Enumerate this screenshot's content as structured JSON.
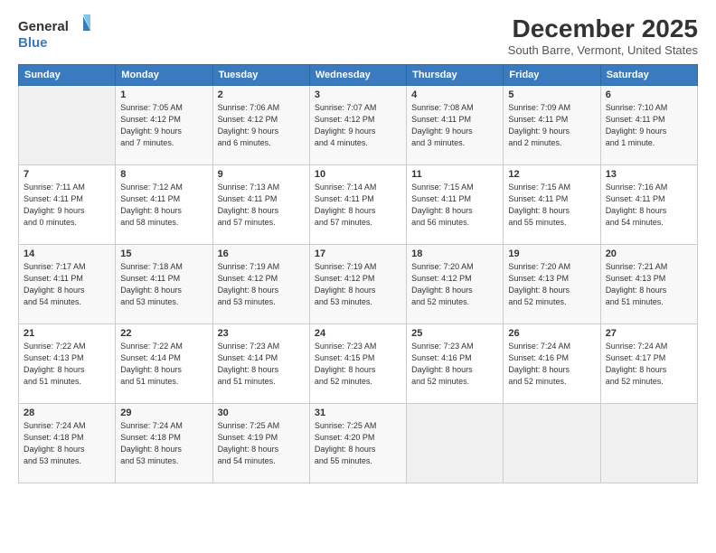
{
  "header": {
    "logo_general": "General",
    "logo_blue": "Blue",
    "title": "December 2025",
    "subtitle": "South Barre, Vermont, United States"
  },
  "weekdays": [
    "Sunday",
    "Monday",
    "Tuesday",
    "Wednesday",
    "Thursday",
    "Friday",
    "Saturday"
  ],
  "weeks": [
    [
      {
        "day": "",
        "info": ""
      },
      {
        "day": "1",
        "info": "Sunrise: 7:05 AM\nSunset: 4:12 PM\nDaylight: 9 hours\nand 7 minutes."
      },
      {
        "day": "2",
        "info": "Sunrise: 7:06 AM\nSunset: 4:12 PM\nDaylight: 9 hours\nand 6 minutes."
      },
      {
        "day": "3",
        "info": "Sunrise: 7:07 AM\nSunset: 4:12 PM\nDaylight: 9 hours\nand 4 minutes."
      },
      {
        "day": "4",
        "info": "Sunrise: 7:08 AM\nSunset: 4:11 PM\nDaylight: 9 hours\nand 3 minutes."
      },
      {
        "day": "5",
        "info": "Sunrise: 7:09 AM\nSunset: 4:11 PM\nDaylight: 9 hours\nand 2 minutes."
      },
      {
        "day": "6",
        "info": "Sunrise: 7:10 AM\nSunset: 4:11 PM\nDaylight: 9 hours\nand 1 minute."
      }
    ],
    [
      {
        "day": "7",
        "info": "Sunrise: 7:11 AM\nSunset: 4:11 PM\nDaylight: 9 hours\nand 0 minutes."
      },
      {
        "day": "8",
        "info": "Sunrise: 7:12 AM\nSunset: 4:11 PM\nDaylight: 8 hours\nand 58 minutes."
      },
      {
        "day": "9",
        "info": "Sunrise: 7:13 AM\nSunset: 4:11 PM\nDaylight: 8 hours\nand 57 minutes."
      },
      {
        "day": "10",
        "info": "Sunrise: 7:14 AM\nSunset: 4:11 PM\nDaylight: 8 hours\nand 57 minutes."
      },
      {
        "day": "11",
        "info": "Sunrise: 7:15 AM\nSunset: 4:11 PM\nDaylight: 8 hours\nand 56 minutes."
      },
      {
        "day": "12",
        "info": "Sunrise: 7:15 AM\nSunset: 4:11 PM\nDaylight: 8 hours\nand 55 minutes."
      },
      {
        "day": "13",
        "info": "Sunrise: 7:16 AM\nSunset: 4:11 PM\nDaylight: 8 hours\nand 54 minutes."
      }
    ],
    [
      {
        "day": "14",
        "info": "Sunrise: 7:17 AM\nSunset: 4:11 PM\nDaylight: 8 hours\nand 54 minutes."
      },
      {
        "day": "15",
        "info": "Sunrise: 7:18 AM\nSunset: 4:11 PM\nDaylight: 8 hours\nand 53 minutes."
      },
      {
        "day": "16",
        "info": "Sunrise: 7:19 AM\nSunset: 4:12 PM\nDaylight: 8 hours\nand 53 minutes."
      },
      {
        "day": "17",
        "info": "Sunrise: 7:19 AM\nSunset: 4:12 PM\nDaylight: 8 hours\nand 53 minutes."
      },
      {
        "day": "18",
        "info": "Sunrise: 7:20 AM\nSunset: 4:12 PM\nDaylight: 8 hours\nand 52 minutes."
      },
      {
        "day": "19",
        "info": "Sunrise: 7:20 AM\nSunset: 4:13 PM\nDaylight: 8 hours\nand 52 minutes."
      },
      {
        "day": "20",
        "info": "Sunrise: 7:21 AM\nSunset: 4:13 PM\nDaylight: 8 hours\nand 51 minutes."
      }
    ],
    [
      {
        "day": "21",
        "info": "Sunrise: 7:22 AM\nSunset: 4:13 PM\nDaylight: 8 hours\nand 51 minutes."
      },
      {
        "day": "22",
        "info": "Sunrise: 7:22 AM\nSunset: 4:14 PM\nDaylight: 8 hours\nand 51 minutes."
      },
      {
        "day": "23",
        "info": "Sunrise: 7:23 AM\nSunset: 4:14 PM\nDaylight: 8 hours\nand 51 minutes."
      },
      {
        "day": "24",
        "info": "Sunrise: 7:23 AM\nSunset: 4:15 PM\nDaylight: 8 hours\nand 52 minutes."
      },
      {
        "day": "25",
        "info": "Sunrise: 7:23 AM\nSunset: 4:16 PM\nDaylight: 8 hours\nand 52 minutes."
      },
      {
        "day": "26",
        "info": "Sunrise: 7:24 AM\nSunset: 4:16 PM\nDaylight: 8 hours\nand 52 minutes."
      },
      {
        "day": "27",
        "info": "Sunrise: 7:24 AM\nSunset: 4:17 PM\nDaylight: 8 hours\nand 52 minutes."
      }
    ],
    [
      {
        "day": "28",
        "info": "Sunrise: 7:24 AM\nSunset: 4:18 PM\nDaylight: 8 hours\nand 53 minutes."
      },
      {
        "day": "29",
        "info": "Sunrise: 7:24 AM\nSunset: 4:18 PM\nDaylight: 8 hours\nand 53 minutes."
      },
      {
        "day": "30",
        "info": "Sunrise: 7:25 AM\nSunset: 4:19 PM\nDaylight: 8 hours\nand 54 minutes."
      },
      {
        "day": "31",
        "info": "Sunrise: 7:25 AM\nSunset: 4:20 PM\nDaylight: 8 hours\nand 55 minutes."
      },
      {
        "day": "",
        "info": ""
      },
      {
        "day": "",
        "info": ""
      },
      {
        "day": "",
        "info": ""
      }
    ]
  ]
}
